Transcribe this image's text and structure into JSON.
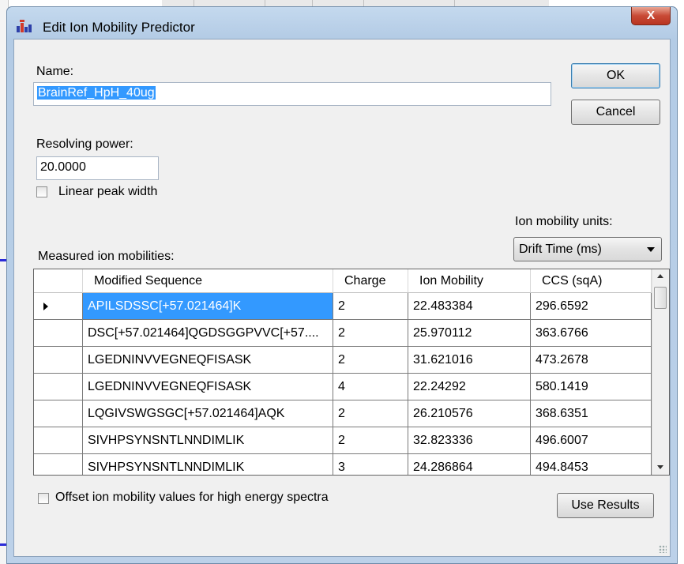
{
  "window": {
    "title": "Edit Ion Mobility Predictor",
    "close_glyph": "X"
  },
  "form": {
    "name_label": "Name:",
    "name_value": "BrainRef_HpH_40ug",
    "resolving_power_label": "Resolving power:",
    "resolving_power_value": "20.0000",
    "linear_peak_width_label": "Linear peak width",
    "linear_peak_width_checked": false,
    "ion_mobility_units_label": "Ion mobility units:",
    "ion_mobility_units_value": "Drift Time (ms)",
    "measured_label": "Measured ion mobilities:",
    "offset_label": "Offset ion mobility values for high energy spectra",
    "offset_checked": false
  },
  "buttons": {
    "ok": "OK",
    "cancel": "Cancel",
    "use_results": "Use Results"
  },
  "grid": {
    "columns": [
      "Modified Sequence",
      "Charge",
      "Ion Mobility",
      "CCS (sqA)"
    ],
    "rows": [
      [
        "APILSDSSC[+57.021464]K",
        "2",
        "22.483384",
        "296.6592"
      ],
      [
        "DSC[+57.021464]QGDSGGPVVC[+57....",
        "2",
        "25.970112",
        "363.6766"
      ],
      [
        "LGEDNINVVEGNEQFISASK",
        "2",
        "31.621016",
        "473.2678"
      ],
      [
        "LGEDNINVVEGNEQFISASK",
        "4",
        "22.24292",
        "580.1419"
      ],
      [
        "LQGIVSWGSGC[+57.021464]AQK",
        "2",
        "26.210576",
        "368.6351"
      ],
      [
        "SIVHPSYNSNTLNNDIMLIK",
        "2",
        "32.823336",
        "496.6007"
      ],
      [
        "SIVHPSYNSNTLNNDIMLIK",
        "3",
        "24.286864",
        "494.8453"
      ]
    ],
    "selected_row": 0
  },
  "colors": {
    "selection": "#3399ff",
    "frame": "#bcd1e9",
    "close": "#c84a36"
  }
}
